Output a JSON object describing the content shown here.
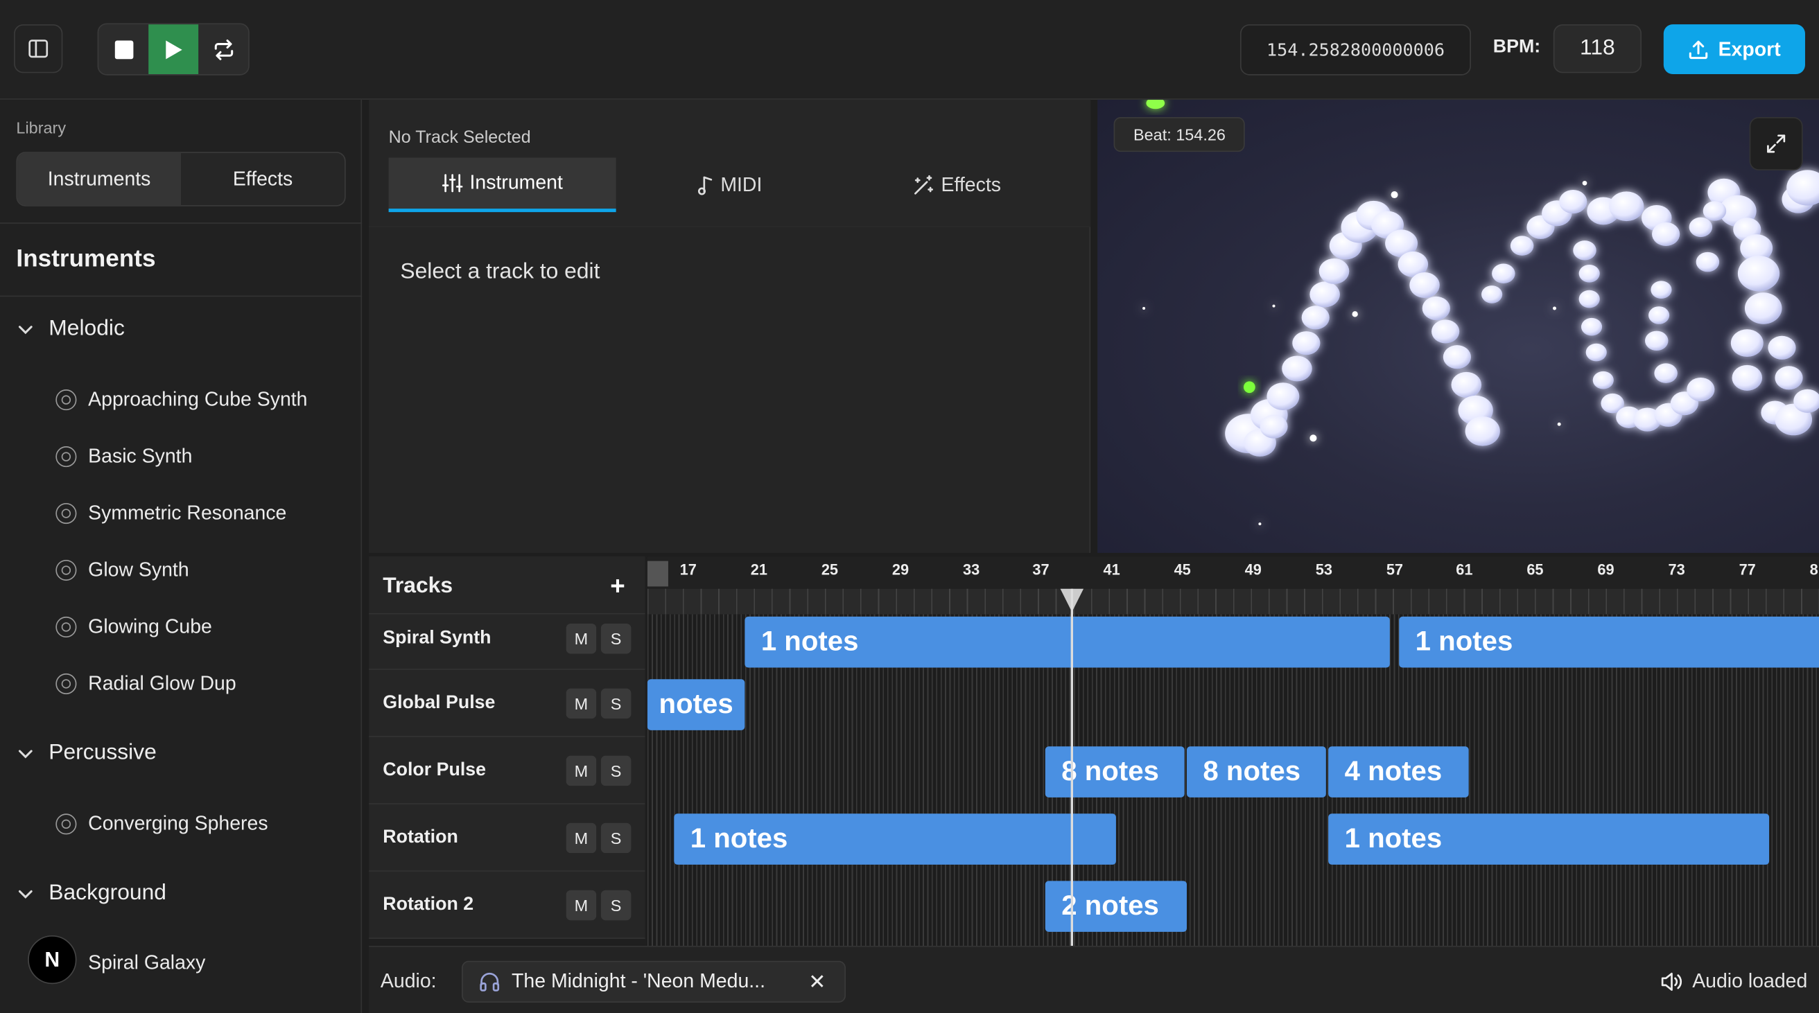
{
  "transport": {
    "time": "154.2582800000006",
    "bpm_label": "BPM:",
    "bpm_value": "118",
    "export_label": "Export"
  },
  "sidebar": {
    "library_label": "Library",
    "tabs": [
      {
        "label": "Instruments",
        "active": true
      },
      {
        "label": "Effects",
        "active": false
      }
    ],
    "section_title": "Instruments",
    "groups": [
      {
        "label": "Melodic",
        "items": [
          "Approaching Cube Synth",
          "Basic Synth",
          "Symmetric Resonance",
          "Glow Synth",
          "Glowing Cube",
          "Radial Glow Dup"
        ]
      },
      {
        "label": "Percussive",
        "items": [
          "Converging Spheres"
        ]
      },
      {
        "label": "Background",
        "items": [
          "Spiral Galaxy"
        ]
      }
    ],
    "avatar_letter": "N"
  },
  "editor": {
    "status": "No Track Selected",
    "tabs": [
      {
        "label": "Instrument",
        "active": true
      },
      {
        "label": "MIDI",
        "active": false
      },
      {
        "label": "Effects",
        "active": false
      }
    ],
    "message": "Select a track to edit"
  },
  "visualizer": {
    "beat_label": "Beat: 154.26"
  },
  "timeline": {
    "title": "Tracks",
    "add_symbol": "+",
    "ruler_ticks": [
      "17",
      "21",
      "25",
      "29",
      "33",
      "37",
      "41",
      "45",
      "49",
      "53",
      "57",
      "61",
      "65",
      "69",
      "73",
      "77",
      "8"
    ],
    "mute_label": "M",
    "solo_label": "S",
    "tracks": [
      {
        "name": "Spiral Synth",
        "clips": [
          "1 notes",
          "1 notes"
        ]
      },
      {
        "name": "Global Pulse",
        "clips": [
          "notes"
        ]
      },
      {
        "name": "Color Pulse",
        "clips": [
          "8 notes",
          "8 notes",
          "4 notes"
        ]
      },
      {
        "name": "Rotation",
        "clips": [
          "1 notes",
          "1 notes"
        ]
      },
      {
        "name": "Rotation 2",
        "clips": [
          "2 notes"
        ]
      }
    ]
  },
  "audio": {
    "label": "Audio:",
    "file_name": "The Midnight - 'Neon Medu...",
    "close_symbol": "✕",
    "status": "Audio loaded"
  },
  "colors": {
    "accent": "#0ea5e9",
    "play": "#2f8f4e",
    "clip": "#4a90e2"
  }
}
